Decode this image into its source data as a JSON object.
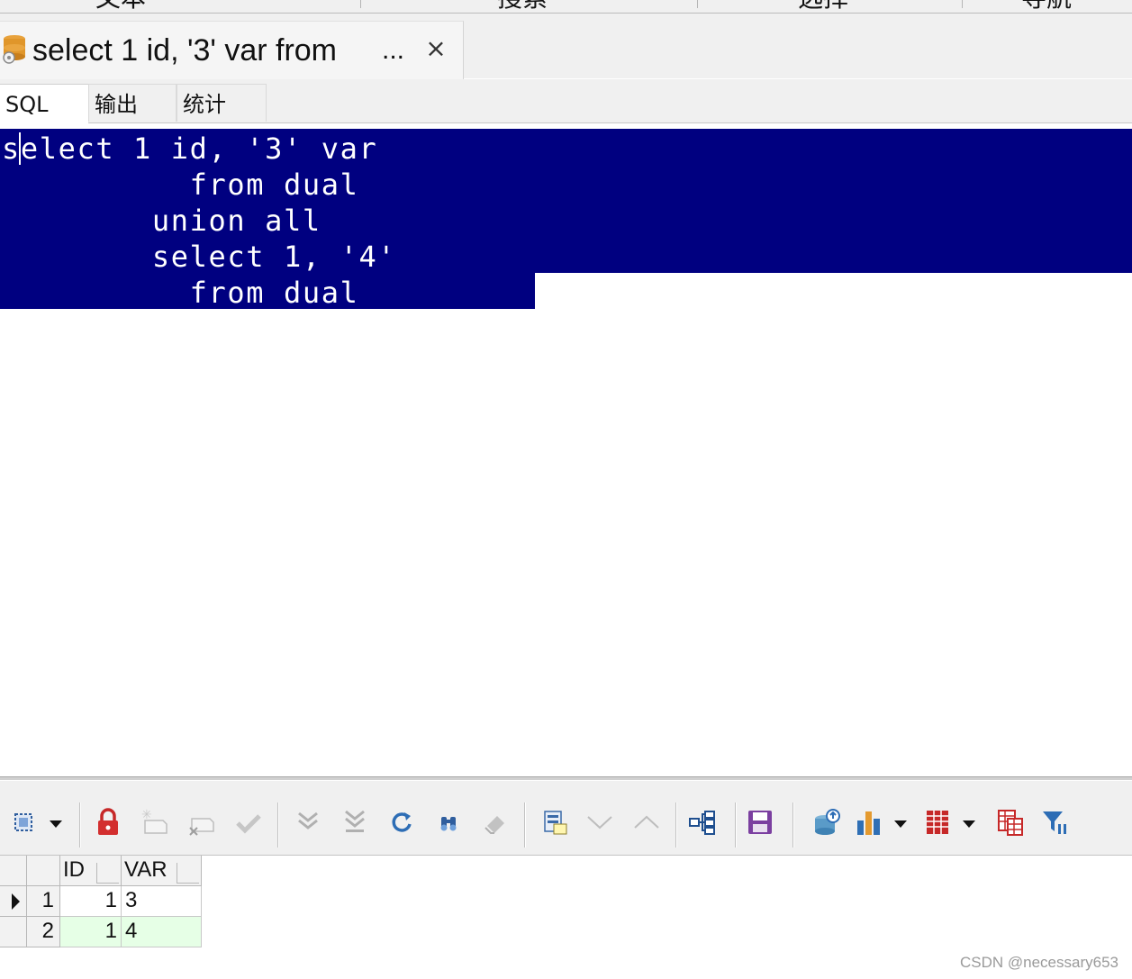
{
  "menu": {
    "items": [
      "文本",
      "搜索",
      "选择",
      "导航"
    ]
  },
  "document_tab": {
    "title": "select 1 id, '3' var from",
    "ellipsis": "...",
    "close": "×"
  },
  "sub_tabs": [
    {
      "label": "SQL",
      "active": true
    },
    {
      "label": "输出",
      "active": false
    },
    {
      "label": "统计",
      "active": false
    }
  ],
  "editor": {
    "lines": [
      "select 1 id, '3' var",
      "          from dual",
      "        union all",
      "        select 1, '4'",
      "          from dual"
    ],
    "selection_color": "#000080"
  },
  "toolbar": {
    "icons": [
      "select-mode-icon",
      "lock-icon",
      "insert-record-icon",
      "delete-record-icon",
      "post-icon",
      "fetch-next-icon",
      "fetch-last-icon",
      "refresh-icon",
      "find-icon",
      "clear-icon",
      "single-record-view-icon",
      "next-record-icon",
      "previous-record-icon",
      "query-tree-icon",
      "save-icon",
      "export-db-icon",
      "chart-icon",
      "table-grid-icon",
      "table-export-icon",
      "filter-icon"
    ]
  },
  "grid": {
    "columns": [
      "ID",
      "VAR"
    ],
    "rows": [
      {
        "num": "1",
        "id": "1",
        "var": "3",
        "current": true
      },
      {
        "num": "2",
        "id": "1",
        "var": "4",
        "current": false
      }
    ],
    "alt_row_color": "#e6ffe6"
  },
  "watermark": "CSDN @necessary653"
}
